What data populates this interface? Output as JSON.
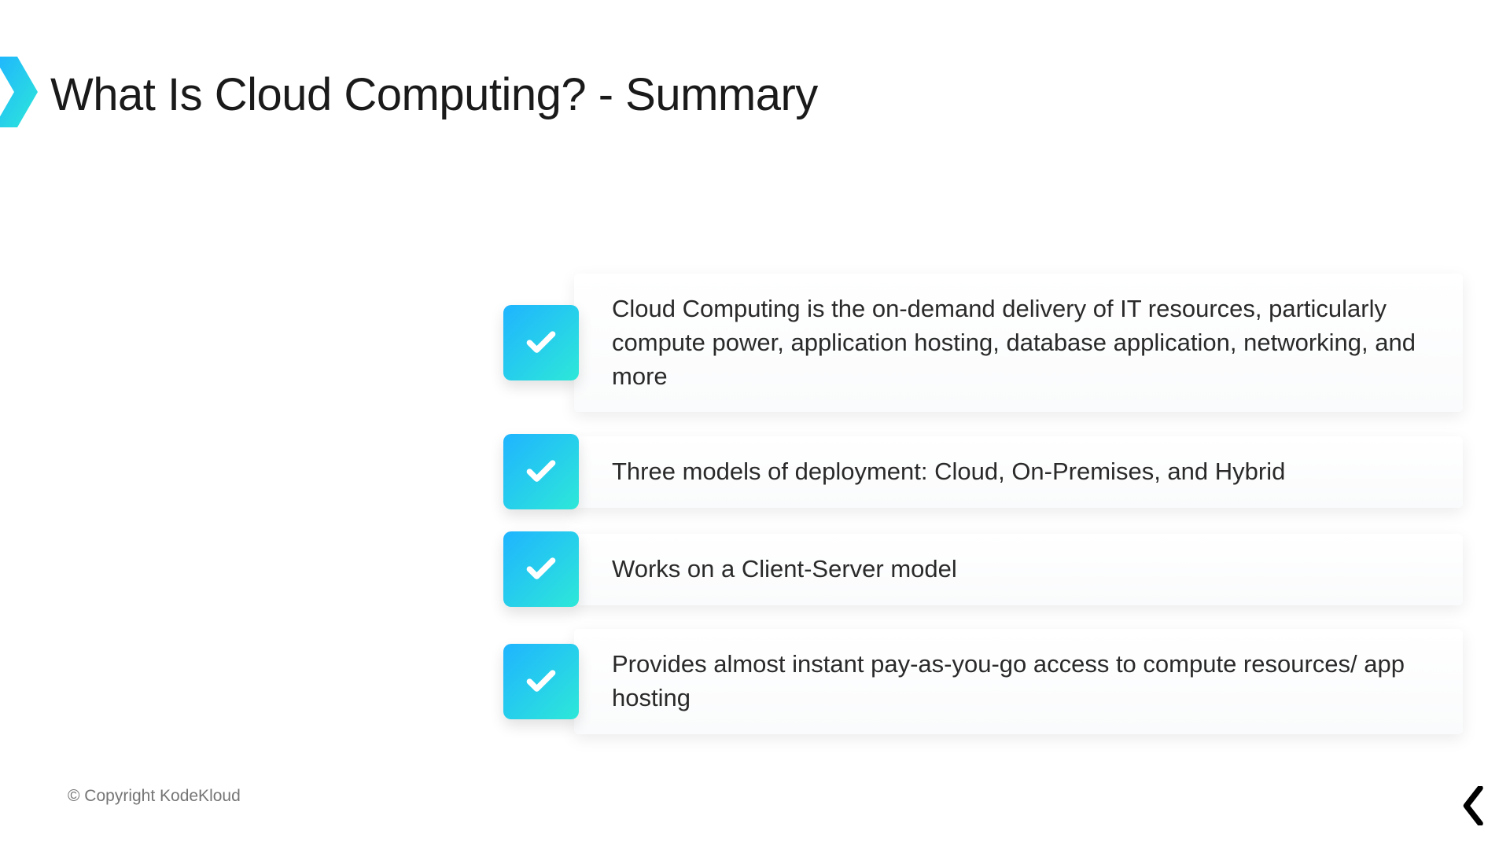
{
  "slide": {
    "title": "What Is Cloud Computing? - Summary",
    "bullets": [
      "Cloud Computing is the on-demand delivery of IT resources, particularly compute power, application hosting, database application, networking, and more",
      "Three models of deployment: Cloud, On-Premises, and Hybrid",
      "Works on a Client-Server model",
      "Provides almost instant pay-as-you-go access to compute resources/ app hosting"
    ],
    "copyright": "© Copyright KodeKloud"
  },
  "colors": {
    "accent_start": "#1fb4ff",
    "accent_end": "#2de8d8"
  }
}
